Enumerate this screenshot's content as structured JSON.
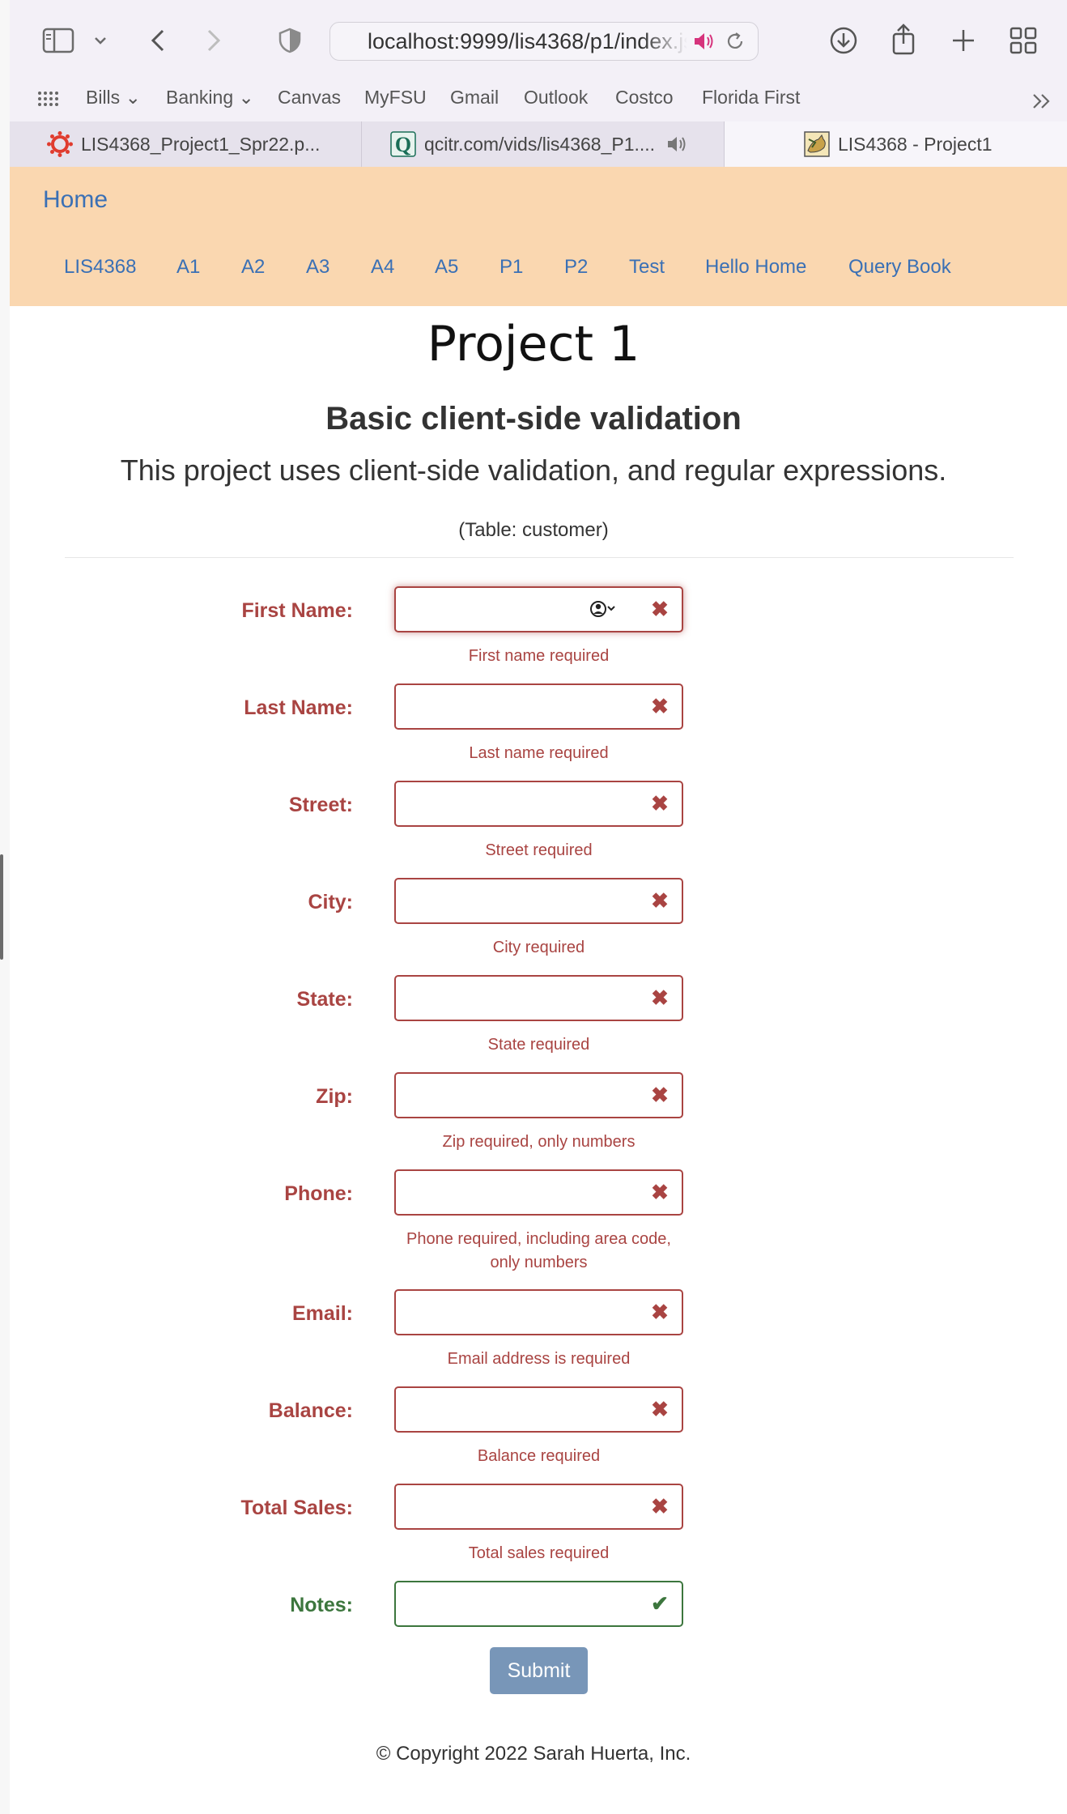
{
  "browser": {
    "url": "localhost:9999/lis4368/p1/index.jsp",
    "bookmarks": [
      "Bills",
      "Banking",
      "Canvas",
      "MyFSU",
      "Gmail",
      "Outlook",
      "Costco",
      "Florida First"
    ],
    "tabs": [
      {
        "label": "LIS4368_Project1_Spr22.p...",
        "active": false
      },
      {
        "label": "qcitr.com/vids/lis4368_P1....",
        "active": false,
        "audio": true
      },
      {
        "label": "LIS4368 - Project1",
        "active": true
      }
    ]
  },
  "nav": {
    "brand": "Home",
    "links": [
      "LIS4368",
      "A1",
      "A2",
      "A3",
      "A4",
      "A5",
      "P1",
      "P2",
      "Test",
      "Hello Home",
      "Query Book"
    ]
  },
  "page": {
    "title": "Project 1",
    "subtitle": "Basic client-side validation",
    "lead": "This project uses client-side validation, and regular expressions.",
    "table_note": "(Table: customer)"
  },
  "form": {
    "fields": [
      {
        "label": "First Name:",
        "value": "",
        "status": "error",
        "help": "First name required"
      },
      {
        "label": "Last Name:",
        "value": "",
        "status": "error",
        "help": "Last name required"
      },
      {
        "label": "Street:",
        "value": "",
        "status": "error",
        "help": "Street required"
      },
      {
        "label": "City:",
        "value": "",
        "status": "error",
        "help": "City required"
      },
      {
        "label": "State:",
        "value": "",
        "status": "error",
        "help": "State required"
      },
      {
        "label": "Zip:",
        "value": "",
        "status": "error",
        "help": "Zip required, only numbers"
      },
      {
        "label": "Phone:",
        "value": "",
        "status": "error",
        "help": "Phone required, including area code, only numbers"
      },
      {
        "label": "Email:",
        "value": "",
        "status": "error",
        "help": "Email address is required"
      },
      {
        "label": "Balance:",
        "value": "",
        "status": "error",
        "help": "Balance required"
      },
      {
        "label": "Total Sales:",
        "value": "",
        "status": "error",
        "help": "Total sales required"
      },
      {
        "label": "Notes:",
        "value": "",
        "status": "success",
        "help": ""
      }
    ],
    "submit_label": "Submit"
  },
  "footer": "© Copyright 2022 Sarah Huerta, Inc.",
  "colors": {
    "error": "#a94442",
    "success": "#3c763d",
    "link": "#3a70b5",
    "navbar": "#fad7b0",
    "submit": "#7896b8"
  },
  "icons": {
    "error": "cross-icon",
    "success": "check-icon"
  }
}
